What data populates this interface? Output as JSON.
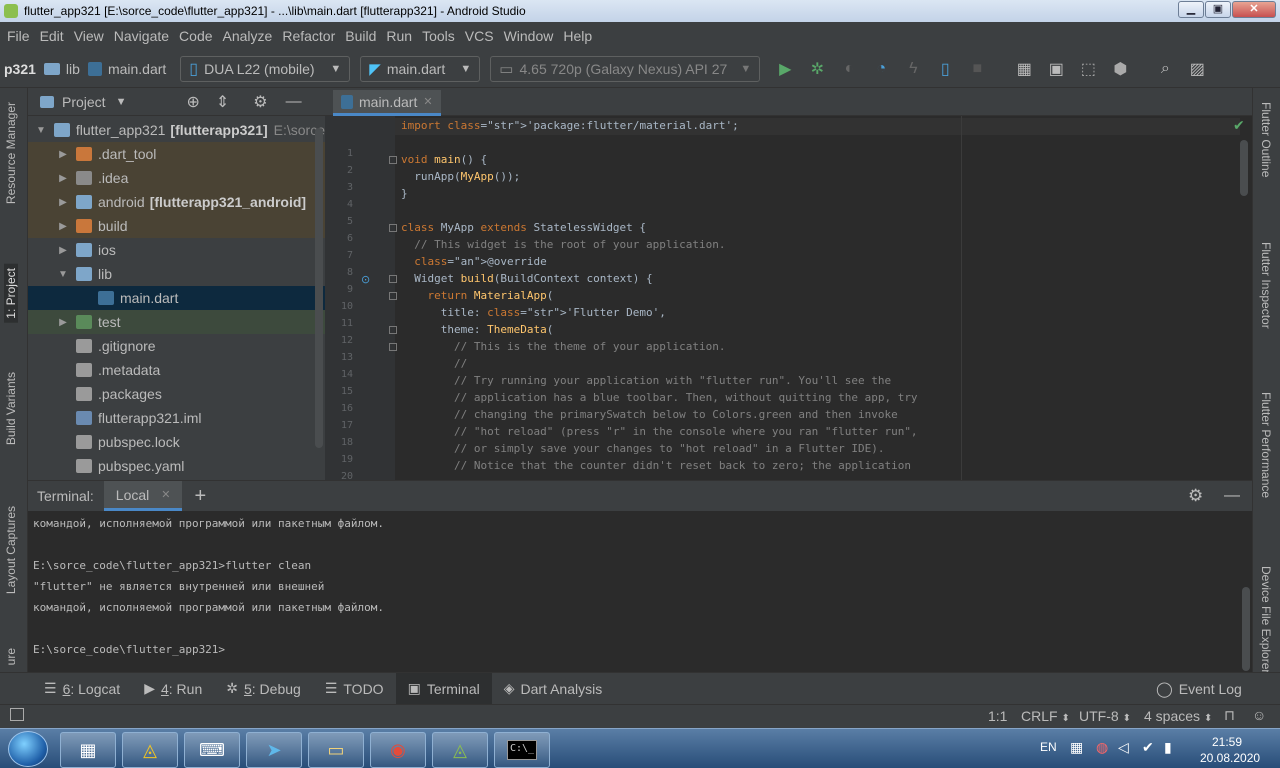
{
  "window": {
    "title": "flutter_app321 [E:\\sorce_code\\flutter_app321] - ...\\lib\\main.dart [flutterapp321] - Android Studio",
    "minimize": "▁",
    "maximize": "▣",
    "close": "✕"
  },
  "menu": [
    "File",
    "Edit",
    "View",
    "Navigate",
    "Code",
    "Analyze",
    "Refactor",
    "Build",
    "Run",
    "Tools",
    "VCS",
    "Window",
    "Help"
  ],
  "toolbar": {
    "crumb_project": "p321",
    "crumb_lib": "lib",
    "crumb_file": "main.dart",
    "device": "DUA L22 (mobile)",
    "config": "main.dart",
    "avd": "4.65  720p (Galaxy Nexus) API 27"
  },
  "left_tools": [
    "Resource Manager",
    "1: Project",
    "Build Variants",
    "Layout Captures",
    "ure"
  ],
  "right_tools": [
    "Flutter Outline",
    "Flutter Inspector",
    "Flutter Performance",
    "Device File Explorer"
  ],
  "project_panel": {
    "title": "Project",
    "tree": [
      {
        "label": "flutter_app321",
        "bold": "[flutterapp321]",
        "extra": "E:\\sorce",
        "indent": 0,
        "expanded": "▼"
      },
      {
        "label": ".dart_tool",
        "indent": 1,
        "expanded": "▶"
      },
      {
        "label": ".idea",
        "indent": 1,
        "expanded": "▶"
      },
      {
        "label": "android",
        "bold": "[flutterapp321_android]",
        "indent": 1,
        "expanded": "▶"
      },
      {
        "label": "build",
        "indent": 1,
        "expanded": "▶"
      },
      {
        "label": "ios",
        "indent": 1,
        "expanded": "▶"
      },
      {
        "label": "lib",
        "indent": 1,
        "expanded": "▼"
      },
      {
        "label": "main.dart",
        "indent": 2,
        "expanded": ""
      },
      {
        "label": "test",
        "indent": 1,
        "expanded": "▶"
      },
      {
        "label": ".gitignore",
        "indent": 1,
        "expanded": ""
      },
      {
        "label": ".metadata",
        "indent": 1,
        "expanded": ""
      },
      {
        "label": ".packages",
        "indent": 1,
        "expanded": ""
      },
      {
        "label": "flutterapp321.iml",
        "indent": 1,
        "expanded": ""
      },
      {
        "label": "pubspec.lock",
        "indent": 1,
        "expanded": ""
      },
      {
        "label": "pubspec.yaml",
        "indent": 1,
        "expanded": ""
      }
    ]
  },
  "editor": {
    "tab": "main.dart",
    "tab_close": "✕",
    "lines": [
      {
        "n": "1",
        "t": "import 'package:flutter/material.dart';"
      },
      {
        "n": "2",
        "t": ""
      },
      {
        "n": "3",
        "t": "void main() {"
      },
      {
        "n": "4",
        "t": "  runApp(MyApp());"
      },
      {
        "n": "5",
        "t": "}"
      },
      {
        "n": "6",
        "t": ""
      },
      {
        "n": "7",
        "t": "class MyApp extends StatelessWidget {"
      },
      {
        "n": "8",
        "t": "  // This widget is the root of your application."
      },
      {
        "n": "9",
        "t": "  @override"
      },
      {
        "n": "10",
        "t": "  Widget build(BuildContext context) {"
      },
      {
        "n": "11",
        "t": "    return MaterialApp("
      },
      {
        "n": "12",
        "t": "      title: 'Flutter Demo',"
      },
      {
        "n": "13",
        "t": "      theme: ThemeData("
      },
      {
        "n": "14",
        "t": "        // This is the theme of your application."
      },
      {
        "n": "15",
        "t": "        //"
      },
      {
        "n": "16",
        "t": "        // Try running your application with \"flutter run\". You'll see the"
      },
      {
        "n": "17",
        "t": "        // application has a blue toolbar. Then, without quitting the app, try"
      },
      {
        "n": "18",
        "t": "        // changing the primarySwatch below to Colors.green and then invoke"
      },
      {
        "n": "19",
        "t": "        // \"hot reload\" (press \"r\" in the console where you ran \"flutter run\","
      },
      {
        "n": "20",
        "t": "        // or simply save your changes to \"hot reload\" in a Flutter IDE)."
      },
      {
        "n": "21",
        "t": "        // Notice that the counter didn't reset back to zero; the application"
      }
    ]
  },
  "terminal": {
    "label": "Terminal:",
    "tab": "Local",
    "tab_close": "✕",
    "add": "+",
    "lines": [
      "командой, исполняемой программой или пакетным файлом.",
      "",
      "E:\\sorce_code\\flutter_app321>flutter clean",
      "\"flutter\" не является внутренней или внешней",
      "командой, исполняемой программой или пакетным файлом.",
      "",
      "E:\\sorce_code\\flutter_app321>"
    ]
  },
  "bottom_tools": [
    {
      "num": "6",
      "label": ": Logcat"
    },
    {
      "num": "4",
      "label": ": Run"
    },
    {
      "num": "5",
      "label": ": Debug"
    },
    {
      "num": "",
      "label": "TODO"
    },
    {
      "num": "",
      "label": "Terminal"
    },
    {
      "num": "",
      "label": "Dart Analysis"
    }
  ],
  "event_log": "Event Log",
  "status": {
    "position": "1:1",
    "line_sep": "CRLF",
    "encoding": "UTF-8",
    "indent": "4 spaces"
  },
  "taskbar": {
    "lang": "EN",
    "time": "21:59",
    "date": "20.08.2020",
    "cmd_label": "C:\\_"
  }
}
